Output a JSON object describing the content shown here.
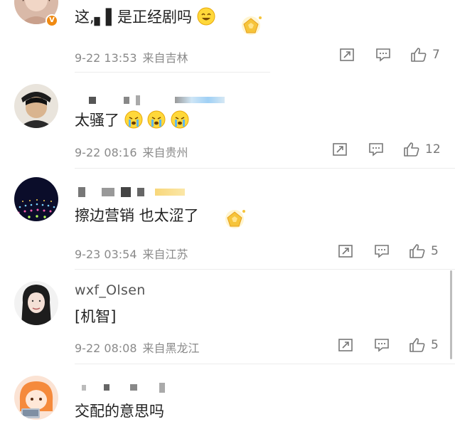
{
  "comments": [
    {
      "text": "这,▖▌是正经剧吗",
      "date": "9-22 13:53",
      "location": "来自吉林",
      "likes": "7"
    },
    {
      "text": "太骚了",
      "date": "9-22 08:16",
      "location": "来自贵州",
      "likes": "12"
    },
    {
      "text": "擦边营销 也太涩了",
      "date": "9-23 03:54",
      "location": "来自江苏",
      "likes": "5"
    },
    {
      "username": "wxf_Olsen",
      "text": "[机智]",
      "date": "9-22 08:08",
      "location": "来自黑龙江",
      "likes": "5"
    },
    {
      "text": "交配的意思吗"
    }
  ],
  "icons": [
    "share-icon",
    "comment-icon",
    "thumbs-up-icon",
    "grin-emoji-icon",
    "crying-emoji-icon",
    "gold-medal-icon",
    "verified-v-badge-icon"
  ],
  "colors": {
    "meta": "#8a8a8a",
    "text": "#222222",
    "badge": "#f08a12"
  }
}
